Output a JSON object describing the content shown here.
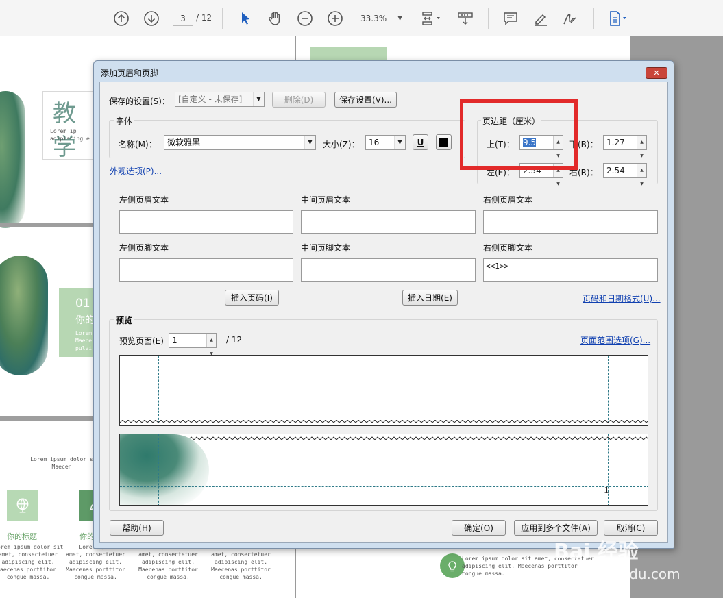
{
  "toolbar": {
    "page_current": "3",
    "page_total": "/ 12",
    "zoom": "33.3%",
    "icons": [
      "prev-page-icon",
      "next-page-icon",
      "select-cursor-icon",
      "hand-icon",
      "zoom-out-icon",
      "zoom-in-icon",
      "fit-page-icon",
      "scroll-mode-icon",
      "comment-icon",
      "highlight-icon",
      "sign-icon",
      "file-icon"
    ]
  },
  "document": {
    "left_title": "教学",
    "left_sub": "Lorem ip\nadipiscing e",
    "num_block": "01",
    "num_sub": "你的",
    "num_body": "Lorem\nMaece\npulvi",
    "lorem_short": "Lorem ipsum dolor s\nMaecen",
    "tile1_title": "你的标题",
    "tile2_title": "你的",
    "col1": "orem ipsum dolor sit\namet, consectetuer\nadipiscing elit.\naecenas porttitor\ncongue massa.",
    "col2": "Lorem ipsu\namet, consectetuer\nadipiscing elit.\nMaecenas porttitor\ncongue massa.",
    "col3": "amet, consectetuer\nadipiscing elit.\nMaecenas porttitor\ncongue massa.",
    "col4": "amet, consectetuer\nadipiscing elit.\nMaecenas porttitor\ncongue massa.",
    "right_lorem": "Lorem ipsum dolor sit amet, consectetuer\nadipiscing elit. Maecenas porttitor\ncongue massa."
  },
  "dialog": {
    "title": "添加页眉和页脚",
    "close_label": "✕",
    "saved_settings_label": "保存的设置(S)：",
    "saved_settings_value": "[自定义 - 未保存]",
    "delete_label": "删除(D)",
    "save_settings_label": "保存设置(V)...",
    "font_group": "字体",
    "name_label": "名称(M)：",
    "font_name": "微软雅黑",
    "size_label": "大小(Z)：",
    "font_size": "16",
    "underline_label": "U",
    "appearance_link": "外观选项(P)...",
    "margin_group": "页边距（厘米）",
    "top_label": "上(T)：",
    "top_value": "9.5",
    "bottom_label": "下(B)：",
    "bottom_value": "1.27",
    "left_label": "左(E)：",
    "left_value": "2.54",
    "right_label": "右(R)：",
    "right_value": "2.54",
    "left_header": "左侧页眉文本",
    "center_header": "中间页眉文本",
    "right_header": "右侧页眉文本",
    "left_footer": "左侧页脚文本",
    "center_footer": "中间页脚文本",
    "right_footer": "右侧页脚文本",
    "right_footer_value": "<<1>>",
    "insert_page_label": "插入页码(I)",
    "insert_date_label": "插入日期(E)",
    "format_link": "页码和日期格式(U)...",
    "preview_group": "预览",
    "preview_page_label": "预览页面(E)",
    "preview_page_value": "1",
    "preview_total": "/ 12",
    "range_link": "页面范围选项(G)...",
    "preview_page_number": "1",
    "help_label": "帮助(H)",
    "ok_label": "确定(O)",
    "apply_multi_label": "应用到多个文件(A)",
    "cancel_label": "取消(C)"
  },
  "watermark": {
    "brand": "Bai 经验",
    "url": "jingyan.baidu.com"
  },
  "colors": {
    "accent_green": "#b7d7b3",
    "highlight_red": "#e22a2a",
    "link_blue": "#1040b0"
  }
}
